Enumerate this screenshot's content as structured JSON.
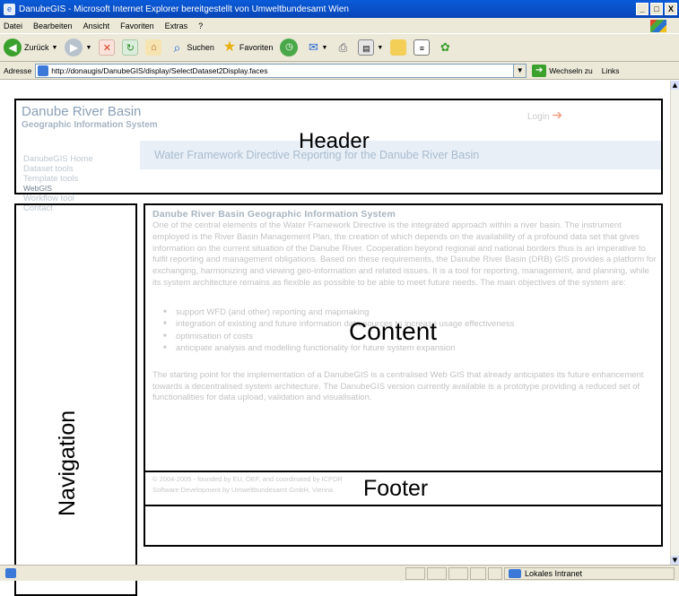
{
  "window": {
    "title": "DanubeGIS - Microsoft Internet Explorer bereitgestellt von Umweltbundesamt Wien",
    "controls": [
      "_",
      "□",
      "X"
    ]
  },
  "menu": [
    "Datei",
    "Bearbeiten",
    "Ansicht",
    "Favoriten",
    "Extras",
    "?"
  ],
  "toolbar": {
    "back": "Zurück",
    "search": "Suchen",
    "favorites": "Favoriten"
  },
  "address": {
    "label": "Adresse",
    "url": "http://donaugis/DanubeGIS/display/SelectDataset2Display.faces",
    "go": "Wechseln zu",
    "links": "Links"
  },
  "site": {
    "brand_title": "Danube River Basin",
    "brand_subtitle": "Geographic Information System",
    "login": "Login",
    "banner": "Water Framework Directive Reporting for the Danube River Basin"
  },
  "nav": {
    "items": [
      "DanubeGIS Home",
      "Dataset tools",
      "Template tools",
      "WebGIS",
      "Workflow tool",
      "Contact"
    ]
  },
  "content": {
    "heading": "Danube River Basin Geographic Information System",
    "paragraph1": "One of the central elements of the Water Framework Directive is the integrated approach within a river basin. The instrument employed is the River Basin Management Plan, the creation of which depends on the availability of a profound data set that gives information on the current situation of the Danube River. Cooperation beyond regional and national borders thus is an imperative to fulfil reporting and management obligations. Based on these requirements, the Danube River Basin (DRB) GIS provides a platform for exchanging, harmonizing and viewing geo-information and related issues. It is a tool for reporting, management, and planning, while its system architecture remains as flexible as possible to be able to meet future needs. The main objectives of the system are:",
    "objectives": [
      "support WFD (and other) reporting and mapmaking",
      "integration of existing and future information data sources to increase usage effectiveness",
      "optimisation of costs",
      "anticipate analysis and modelling functionality for future system expansion"
    ],
    "paragraph2": "The starting point for the implementation of a DanubeGIS is a centralised Web GIS that already anticipates its future enhancement towards a decentralised system architecture. The DanubeGIS version currently available is a prototype providing a reduced set of functionalities for data upload, validation and visualisation."
  },
  "footer": {
    "line1": "© 2004-2005 - founded by EU, ÖEF, and coordinated by ICPDR",
    "line2": "Software Development by Umweltbundesamt GmbH, Vienna"
  },
  "annotations": {
    "header": "Header",
    "navigation": "Navigation",
    "content": "Content",
    "footer": "Footer"
  },
  "status": {
    "zone": "Lokales Intranet"
  }
}
